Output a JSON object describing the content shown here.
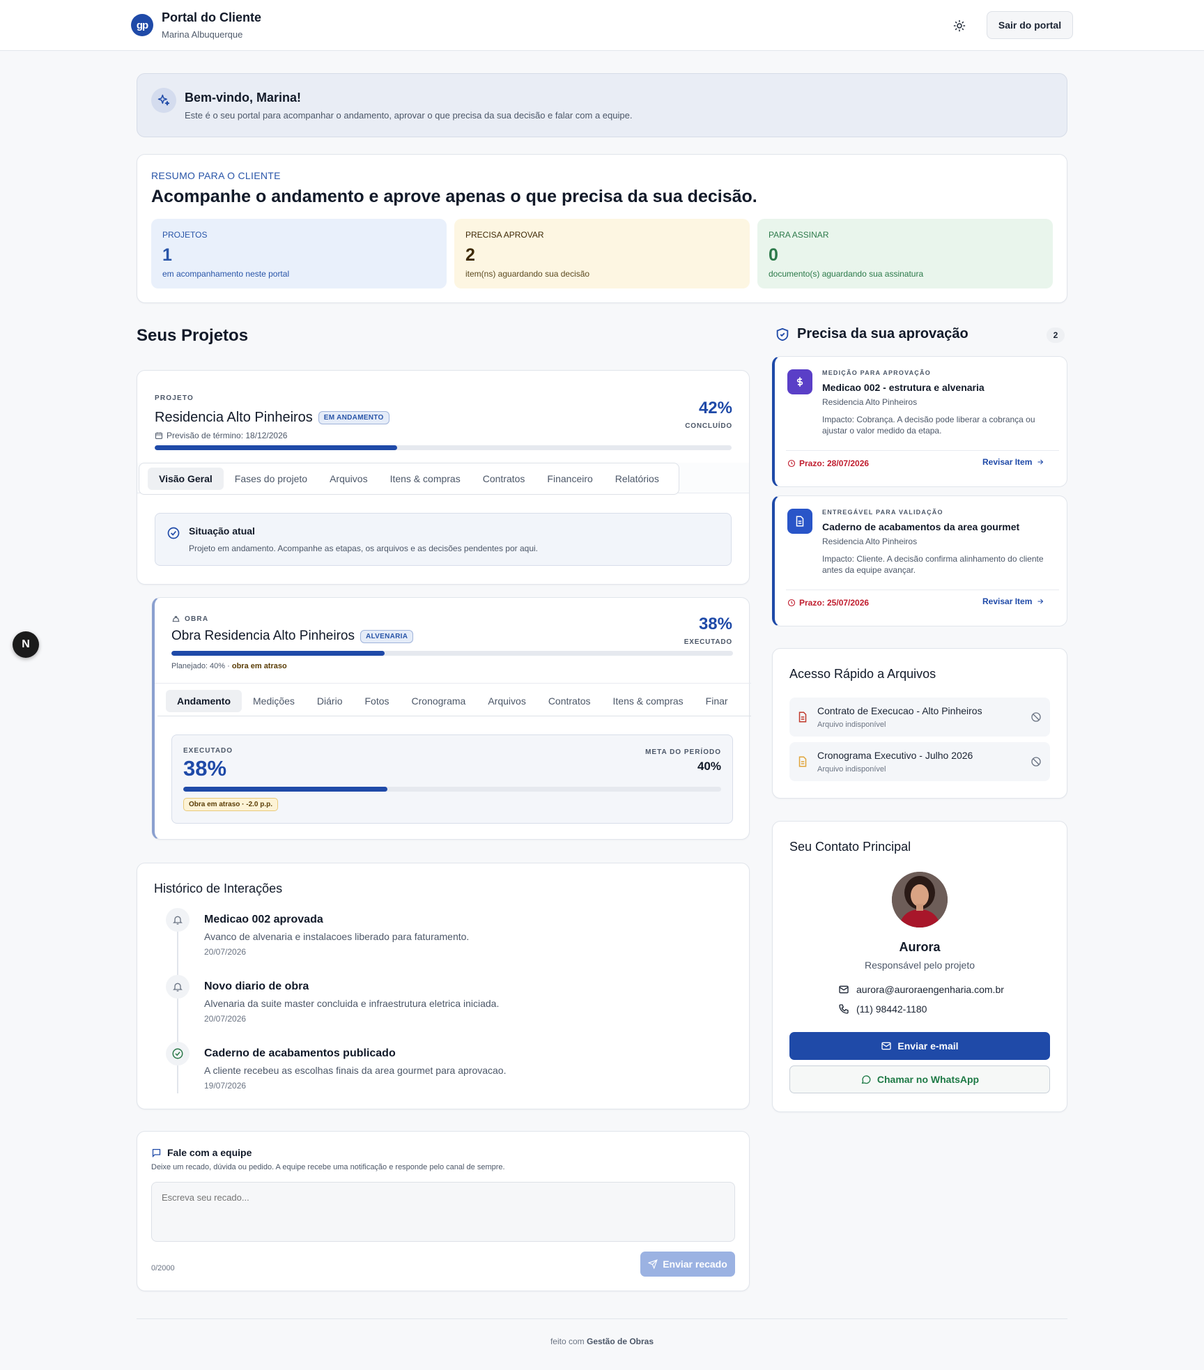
{
  "header": {
    "logo_text": "gp",
    "app_title": "Portal do Cliente",
    "user_name": "Marina Albuquerque",
    "logout_label": "Sair do portal"
  },
  "welcome": {
    "title": "Bem-vindo, Marina!",
    "text": "Este é o seu portal para acompanhar o andamento, aprovar o que precisa da sua decisão e falar com a equipe."
  },
  "summary": {
    "eyebrow": "RESUMO PARA O CLIENTE",
    "title": "Acompanhe o andamento e aprove apenas o que precisa da sua decisão.",
    "stats": [
      {
        "label": "PROJETOS",
        "value": "1",
        "desc": "em acompanhamento neste portal",
        "color": "#2955a8",
        "bg": "#e9f0fb"
      },
      {
        "label": "PRECISA APROVAR",
        "value": "2",
        "desc": "item(ns) aguardando sua decisão",
        "color": "#3e2a06",
        "bg": "#fdf6e2"
      },
      {
        "label": "PARA ASSINAR",
        "value": "0",
        "desc": "documento(s) aguardando sua assinatura",
        "color": "#2c7a4a",
        "bg": "#e9f5ec"
      }
    ]
  },
  "projects": {
    "heading": "Seus Projetos",
    "project": {
      "eyebrow": "PROJETO",
      "name": "Residencia Alto Pinheiros",
      "status": "EM ANDAMENTO",
      "deadline": "Previsão de término: 18/12/2026",
      "percent": "42%",
      "percent_label": "CONCLUÍDO",
      "progress": 0.42,
      "tabs": [
        "Visão Geral",
        "Fases do projeto",
        "Arquivos",
        "Itens & compras",
        "Contratos",
        "Financeiro",
        "Relatórios"
      ],
      "situation_title": "Situação atual",
      "situation_text": "Projeto em andamento. Acompanhe as etapas, os arquivos e as decisões pendentes por aqui."
    },
    "obra": {
      "eyebrow": "OBRA",
      "name": "Obra Residencia Alto Pinheiros",
      "badge": "ALVENARIA",
      "percent": "38%",
      "percent_label": "EXECUTADO",
      "progress": 0.38,
      "planned": "Planejado: 40% ·",
      "delay": "obra em atraso",
      "tabs": [
        "Andamento",
        "Medições",
        "Diário",
        "Fotos",
        "Cronograma",
        "Arquivos",
        "Contratos",
        "Itens & compras",
        "Finar"
      ],
      "executed_label": "EXECUTADO",
      "executed_value": "38%",
      "target_label": "META DO PERÍODO",
      "target_value": "40%",
      "inner_progress": 0.38,
      "delay_badge": "Obra em atraso · -2.0 p.p."
    }
  },
  "history": {
    "title": "Histórico de Interações",
    "items": [
      {
        "title": "Medicao 002 aprovada",
        "desc": "Avanco de alvenaria e instalacoes liberado para faturamento.",
        "date": "20/07/2026",
        "icon": "bell-icon"
      },
      {
        "title": "Novo diario de obra",
        "desc": "Alvenaria da suite master concluida e infraestrutura eletrica iniciada.",
        "date": "20/07/2026",
        "icon": "bell-icon"
      },
      {
        "title": "Caderno de acabamentos publicado",
        "desc": "A cliente recebeu as escolhas finais da area gourmet para aprovacao.",
        "date": "19/07/2026",
        "icon": "check-circle-icon"
      }
    ]
  },
  "message": {
    "title": "Fale com a equipe",
    "subtitle": "Deixe um recado, dúvida ou pedido. A equipe recebe uma notificação e responde pelo canal de sempre.",
    "placeholder": "Escreva seu recado...",
    "counter": "0/2000",
    "send_label": "Enviar recado"
  },
  "approvals": {
    "title": "Precisa da sua aprovação",
    "count": "2",
    "items": [
      {
        "type": "MEDIÇÃO PARA APROVAÇÃO",
        "title": "Medicao 002 - estrutura e alvenaria",
        "project": "Residencia Alto Pinheiros",
        "impact": "Impacto: Cobrança. A decisão pode liberar a cobrança ou ajustar o valor medido da etapa.",
        "deadline": "Prazo: 28/07/2026",
        "action": "Revisar Item",
        "icon": "dollar-icon",
        "icon_color": "#5a3fc7"
      },
      {
        "type": "ENTREGÁVEL PARA VALIDAÇÃO",
        "title": "Caderno de acabamentos da area gourmet",
        "project": "Residencia Alto Pinheiros",
        "impact": "Impacto: Cliente. A decisão confirma alinhamento do cliente antes da equipe avançar.",
        "deadline": "Prazo: 25/07/2026",
        "action": "Revisar Item",
        "icon": "document-icon",
        "icon_color": "#2955c8"
      }
    ]
  },
  "files": {
    "title": "Acesso Rápido a Arquivos",
    "items": [
      {
        "name": "Contrato de Execucao - Alto Pinheiros",
        "status": "Arquivo indisponível",
        "color": "#c0392b"
      },
      {
        "name": "Cronograma Executivo - Julho 2026",
        "status": "Arquivo indisponível",
        "color": "#e0a43a"
      }
    ]
  },
  "contact": {
    "title": "Seu Contato Principal",
    "name": "Aurora",
    "role": "Responsável pelo projeto",
    "email": "aurora@auroraengenharia.com.br",
    "phone": "(11) 98442-1180",
    "email_button": "Enviar e-mail",
    "whatsapp_button": "Chamar no WhatsApp"
  },
  "footer": {
    "prefix": "feito com",
    "brand": "Gestão de Obras"
  },
  "floating_badge": "N"
}
